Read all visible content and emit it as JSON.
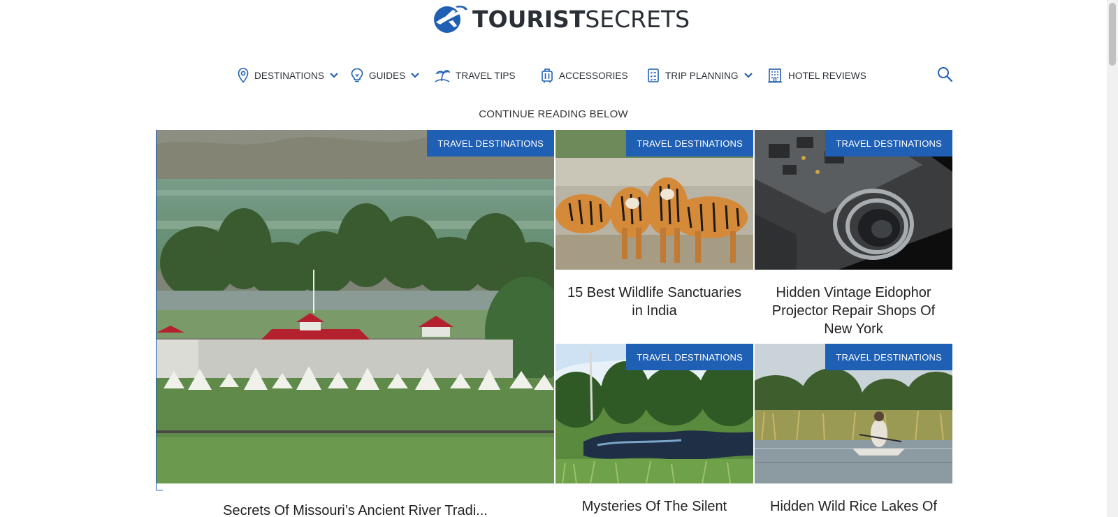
{
  "brand": {
    "name_bold": "TOURIST",
    "name_light": "SECRETS",
    "colors": {
      "primary": "#1f5fb4",
      "text": "#2a2f36"
    }
  },
  "nav": {
    "items": [
      {
        "label": "DESTINATIONS",
        "icon": "location-pin-icon",
        "has_dropdown": true
      },
      {
        "label": "GUIDES",
        "icon": "lightbulb-icon",
        "has_dropdown": true
      },
      {
        "label": "TRAVEL TIPS",
        "icon": "beach-palm-icon",
        "has_dropdown": false
      },
      {
        "label": "ACCESSORIES",
        "icon": "luggage-icon",
        "has_dropdown": false
      },
      {
        "label": "TRIP PLANNING",
        "icon": "checklist-icon",
        "has_dropdown": true
      },
      {
        "label": "HOTEL REVIEWS",
        "icon": "hotel-building-icon",
        "has_dropdown": false
      }
    ],
    "search_icon": "search-icon"
  },
  "continue_label": "CONTINUE READING BELOW",
  "cards": [
    {
      "category": "TRAVEL DESTINATIONS",
      "title": "Secrets Of Missouri’s Ancient River Tradi..."
    },
    {
      "category": "TRAVEL DESTINATIONS",
      "title": "15 Best Wildlife Sanctuaries in India"
    },
    {
      "category": "TRAVEL DESTINATIONS",
      "title": "Hidden Vintage Eidophor Projector Repair Shops Of New York"
    },
    {
      "category": "TRAVEL DESTINATIONS",
      "title": "Mysteries Of The Silent"
    },
    {
      "category": "TRAVEL DESTINATIONS",
      "title": "Hidden Wild Rice Lakes Of"
    }
  ]
}
